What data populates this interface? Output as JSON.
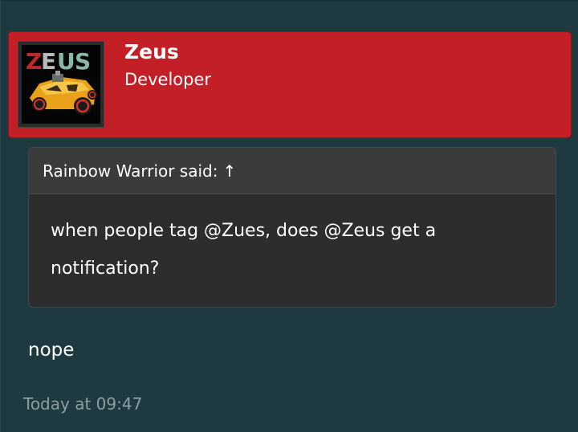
{
  "user": {
    "name": "Zeus",
    "title": "Developer",
    "avatar_logo_text": "ZEUS"
  },
  "quote": {
    "author": "Rainbow Warrior said:",
    "arrow": "↑",
    "text_line1": "when people tag @Zues, does @Zeus get a",
    "text_line2": "notification?"
  },
  "post": {
    "message": "nope",
    "timestamp": "Today at 09:47"
  },
  "colors": {
    "header_bg": "#c22026",
    "page_bg": "#1f3940",
    "quote_bg": "#2d2d2d",
    "quote_head_bg": "#3b3b3b",
    "timestamp": "#8d9ea3"
  }
}
